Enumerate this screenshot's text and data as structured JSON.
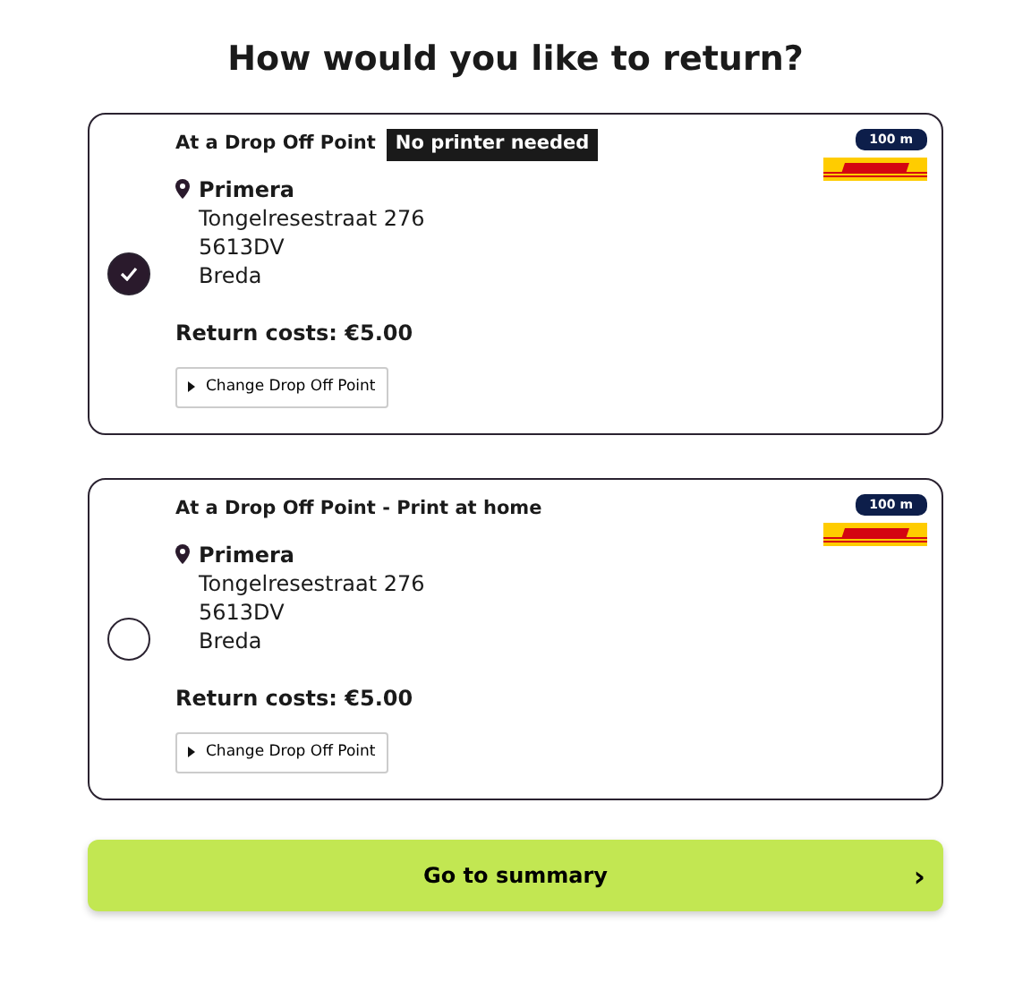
{
  "title": "How would you like to return?",
  "options": [
    {
      "heading": "At a Drop Off Point",
      "tag": "No printer needed",
      "distance": "100 m",
      "selected": true,
      "location": "Primera",
      "address": [
        "Tongelresestraat 276",
        "5613DV",
        "Breda"
      ],
      "cost": "Return costs: €5.00",
      "change_button": "Change Drop Off Point"
    },
    {
      "heading": "At a Drop Off Point - Print at home",
      "distance": "100 m",
      "selected": false,
      "location": "Primera",
      "address": [
        "Tongelresestraat 276",
        "5613DV",
        "Breda"
      ],
      "cost": "Return costs: €5.00",
      "change_button": "Change Drop Off Point"
    }
  ],
  "submit": {
    "label": "Go to summary",
    "chevron": "›"
  }
}
